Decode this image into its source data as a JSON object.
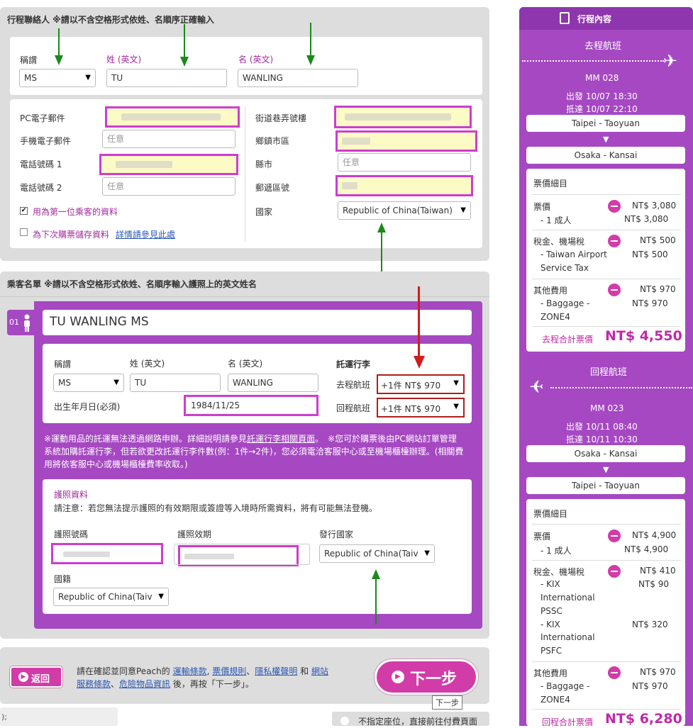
{
  "contact": {
    "title": "行程聯絡人 ※請以不含空格形式依姓、名順序正確輸入",
    "title_label": "稱謂",
    "title_value": "MS",
    "surname_label": "姓 (英文)",
    "surname_value": "TU",
    "given_label": "名 (英文)",
    "given_value": "WANLING",
    "pc_email_label": "PC電子郵件",
    "mobile_email_label": "手機電子郵件",
    "mobile_email_placeholder": "任意",
    "phone1_label": "電話號碼 1",
    "phone2_label": "電話號碼 2",
    "phone2_placeholder": "任意",
    "use_first_passenger": "用為第一位乘客的資料",
    "save_next": "為下次購票儲存資料",
    "details_link": "詳情請參見此處",
    "street_label": "街道巷弄號樓",
    "district_label": "鄉鎮市區",
    "city_label": "縣市",
    "city_placeholder": "任意",
    "postal_label": "郵遞區號",
    "country_label": "國家",
    "country_value": "Republic of China(Taiwan)"
  },
  "passengers": {
    "title": "乘客名單 ※請以不含空格形式依姓、名順序輸入護照上的英文姓名",
    "number": "01",
    "full_name": "TU WANLING MS",
    "title_label": "稱謂",
    "title_value": "MS",
    "surname_label": "姓 (英文)",
    "surname_value": "TU",
    "given_label": "名 (英文)",
    "given_value": "WANLING",
    "dob_label": "出生年月日(必須)",
    "dob_value": "1984/11/25",
    "baggage_title": "託運行李",
    "outbound_label": "去程航班",
    "outbound_value": "+1件 NT$ 970",
    "return_label": "回程航班",
    "return_value": "+1件 NT$ 970",
    "notice_1": "※運動用品的託運無法透過網路申辦。詳細說明請參見",
    "notice_link": "託運行李相關頁面",
    "notice_2": "。　※您可於購票後由PC網站訂單管理",
    "notice_3": "系統加購託運行李，但若欲更改託運行李件數(例：1件→2件)，您必須電洽客服中心或至機場櫃檯辦理。(相關費",
    "notice_4": "用將依客服中心或機場櫃檯費率收取。)",
    "passport_title": "護照資料",
    "passport_note": "請注意：若您無法提示護照的有效期限或簽證等入境時所需資料，將有可能無法登機。",
    "passport_no_label": "護照號碼",
    "passport_exp_label": "護照效期",
    "issuing_label": "發行國家",
    "issuing_value": "Republic of China(Taiv",
    "nationality_label": "國籍",
    "nationality_value": "Republic of China(Taiv"
  },
  "footer": {
    "back_label": "返回",
    "agree_1": "請在確認並同意Peach的",
    "link_terms": "運輸條款",
    "link_fare": "票價規則",
    "link_privacy": "隱私權聲明",
    "and": "和",
    "link_site": "網站",
    "link_service": "服務條款",
    "link_danger": "危險物品資訊",
    "agree_2": "後，再按「下一步」。",
    "next_label": "下一步",
    "tooltip": "下一步",
    "bottom_partial": "不指定座位，直接前往付費頁面",
    "status_text": ");"
  },
  "sidebar": {
    "title": "行程內容",
    "outbound": {
      "heading": "去程航班",
      "flight": "MM 028",
      "depart": "出發 10/07 18:30",
      "arrive": "抵達 10/07 22:10",
      "from": "Taipei - Taoyuan",
      "to": "Osaka - Kansai",
      "fare_title": "票價細目",
      "fare_label": "票價",
      "fare_amount": "NT$ 3,080",
      "fare_sub": "- 1 成人",
      "fare_sub_amount": "NT$ 3,080",
      "tax_label": "稅金、機場稅",
      "tax_amount": "NT$ 500",
      "tax_sub1": "- Taiwan Airport",
      "tax_sub2": "Service Tax",
      "tax_sub_amount": "NT$ 500",
      "other_label": "其他費用",
      "other_amount": "NT$ 970",
      "other_sub1": "- Baggage -",
      "other_sub2": "ZONE4",
      "other_sub_amount": "NT$ 970",
      "total_label": "去程合計票價",
      "total_amount": "NT$ 4,550"
    },
    "return": {
      "heading": "回程航班",
      "flight": "MM 023",
      "depart": "出發 10/11 08:40",
      "arrive": "抵達 10/11 10:30",
      "from": "Osaka - Kansai",
      "to": "Taipei - Taoyuan",
      "fare_title": "票價細目",
      "fare_label": "票價",
      "fare_amount": "NT$ 4,900",
      "fare_sub": "- 1 成人",
      "fare_sub_amount": "NT$ 4,900",
      "tax_label": "稅金、機場稅",
      "tax_amount": "NT$ 410",
      "tax_sub1": "- KIX",
      "tax_sub2": "International",
      "tax_sub3": "PSSC",
      "tax_sub_amount1": "NT$ 90",
      "tax_sub4": "- KIX",
      "tax_sub5": "International",
      "tax_sub6": "PSFC",
      "tax_sub_amount2": "NT$ 320",
      "other_label": "其他費用",
      "other_amount": "NT$ 970",
      "other_sub1": "- Baggage -",
      "other_sub2": "ZONE4",
      "other_sub_amount": "NT$ 970",
      "total_label": "回程合計票價",
      "total_amount": "NT$ 6,280"
    }
  },
  "colors": {
    "purple": "#a548c2",
    "magenta": "#cf3ccf",
    "pink_button": "#d23ca8",
    "arrow_green": "#1a8a1a",
    "arrow_red": "#d21c1c"
  }
}
